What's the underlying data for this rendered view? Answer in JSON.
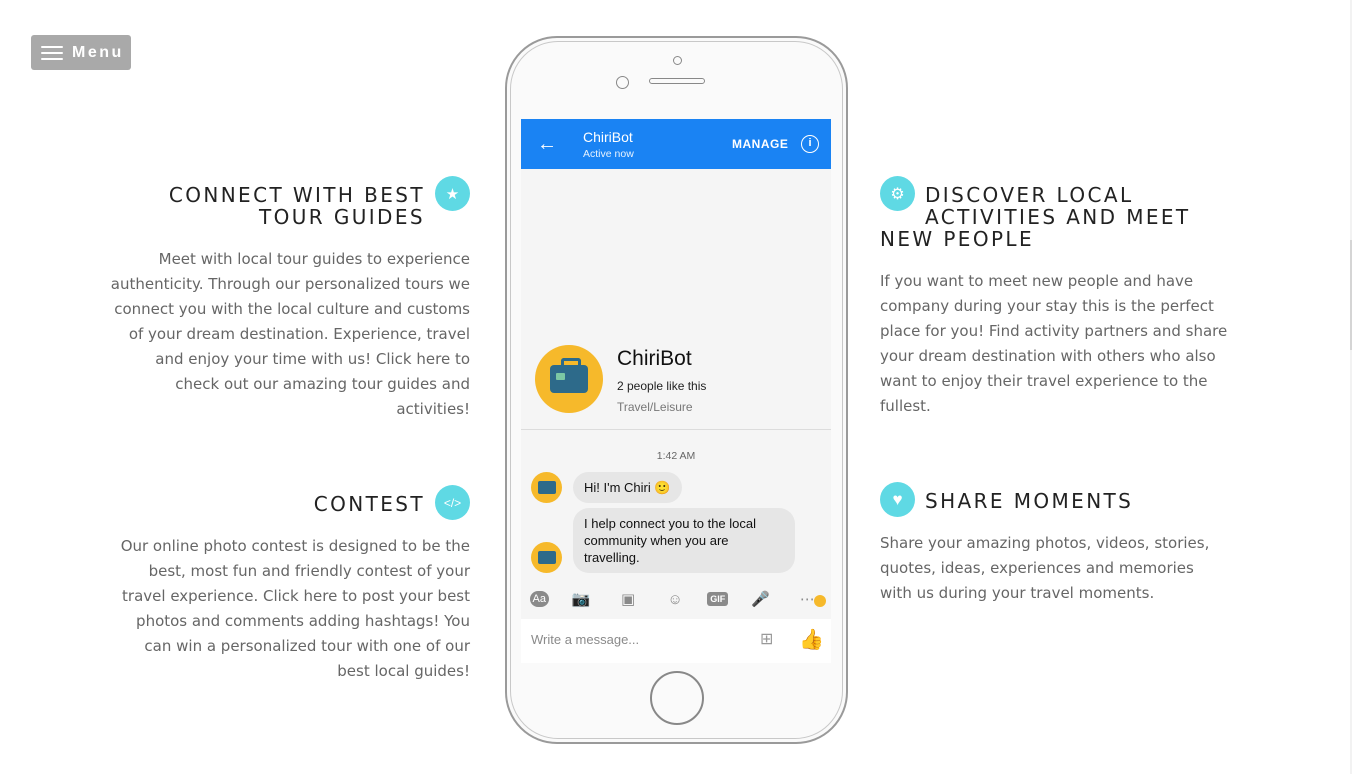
{
  "menu": {
    "label": "Menu"
  },
  "features": {
    "connect": {
      "title_line1": "CONNECT WITH BEST",
      "title_line2": "TOUR GUIDES",
      "text": "Meet with local tour guides to experience authenticity. Through our personalized tours we connect you with the local culture and customs of your dream destination. Experience, travel and enjoy your time with us! Click here to check out our amazing tour guides and activities!",
      "icon": "star-icon"
    },
    "contest": {
      "title": "CONTEST",
      "text": "Our online photo contest is designed to be the best, most fun and friendly contest of your travel experience. Click here to post your best photos and comments adding hashtags! You can win a personalized tour with one of our best local guides!",
      "icon": "code-icon"
    },
    "discover": {
      "title_line1": "DISCOVER LOCAL",
      "title_line2": "ACTIVITIES AND MEET",
      "title_line3": "NEW PEOPLE",
      "text": "If you want to meet new people and have company during your stay this is the perfect place for you! Find activity partners and share your dream destination with others who also want to enjoy their travel experience to the fullest.",
      "icon": "gear-icon"
    },
    "share": {
      "title": "SHARE MOMENTS",
      "text": "Share your amazing photos, videos, stories, quotes, ideas, experiences and memories with us during your travel moments.",
      "icon": "heart-icon"
    }
  },
  "phone": {
    "header": {
      "name": "ChiriBot",
      "status": "Active now",
      "manage": "MANAGE"
    },
    "profile": {
      "name": "ChiriBot",
      "likes": "2 people like this",
      "category": "Travel/Leisure"
    },
    "chat": {
      "time": "1:42 AM",
      "messages": [
        "Hi! I'm Chiri 🙂",
        "I help connect you to the local community when you are travelling."
      ]
    },
    "toolbar": {
      "aa": "Aa",
      "gif": "GIF"
    },
    "input": {
      "placeholder": "Write a message..."
    }
  },
  "colors": {
    "accent": "#5fd9e4",
    "messenger_blue": "#1a83f3",
    "menu_bg": "#a9a9a9"
  }
}
